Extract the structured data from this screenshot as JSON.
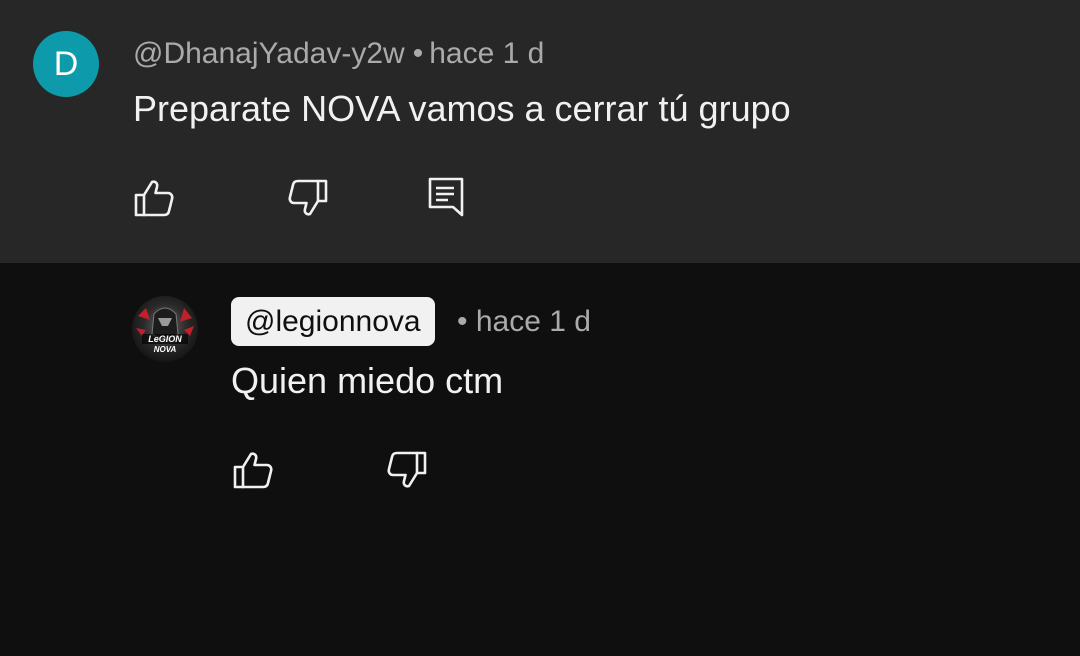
{
  "comment": {
    "avatar_letter": "D",
    "author": "@DhanajYadav-y2w",
    "separator": "•",
    "time": "hace 1 d",
    "text": "Preparate NOVA vamos a cerrar tú grupo",
    "actions": {
      "like_icon": "thumbs-up-icon",
      "dislike_icon": "thumbs-down-icon",
      "reply_icon": "comment-reply-icon"
    },
    "colors": {
      "background": "#272727",
      "avatar": "#0d9bab"
    }
  },
  "reply": {
    "author": "@legionnova",
    "separator": "•",
    "time": "hace 1 d",
    "text": "Quien miedo ctm",
    "avatar_lettering": [
      "LeGION",
      "NOVA"
    ],
    "actions": {
      "like_icon": "thumbs-up-icon",
      "dislike_icon": "thumbs-down-icon"
    },
    "colors": {
      "background": "#0f0f0f",
      "author_chip": "#f1f1f1"
    }
  }
}
